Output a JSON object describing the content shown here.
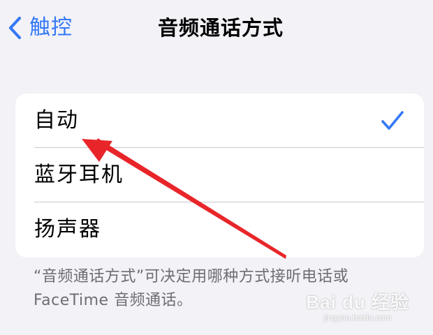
{
  "nav": {
    "back_label": "触控",
    "title": "音频通话方式"
  },
  "options": [
    {
      "label": "自动",
      "selected": true
    },
    {
      "label": "蓝牙耳机",
      "selected": false
    },
    {
      "label": "扬声器",
      "selected": false
    }
  ],
  "footer": {
    "line1": "“音频通话方式”可决定用哪种方式接听电话或",
    "line2": "FaceTime 音频通话。"
  },
  "watermark": {
    "logo": "Bai du 经验",
    "url": "jingyan.baidu.com"
  },
  "colors": {
    "accent": "#3478f6",
    "background": "#f2f2f7",
    "card": "#ffffff",
    "secondary_text": "#6d6d72",
    "annotation": "#e8262a"
  },
  "icons": {
    "back": "chevron-left-icon",
    "selected": "checkmark-icon"
  }
}
